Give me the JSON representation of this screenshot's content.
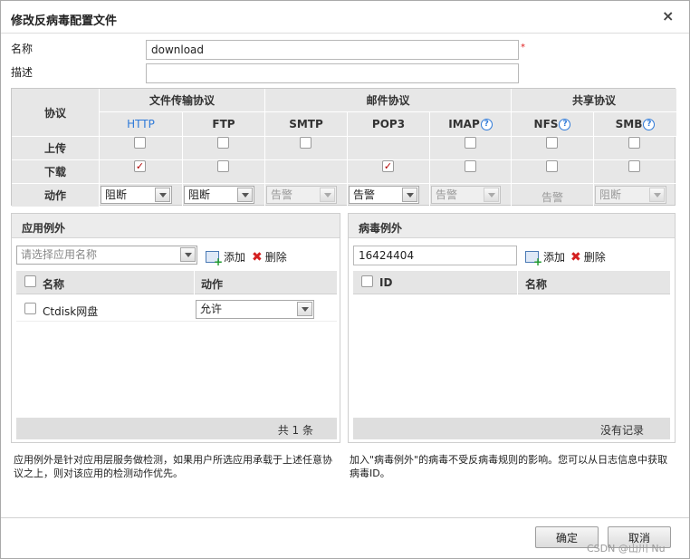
{
  "dialog": {
    "title": "修改反病毒配置文件",
    "close_glyph": "×"
  },
  "form": {
    "name_label": "名称",
    "name_value": "download",
    "required_mark": "*",
    "desc_label": "描述",
    "desc_value": ""
  },
  "protocols": {
    "row_header": "协议",
    "groups": [
      "文件传输协议",
      "邮件协议",
      "共享协议"
    ],
    "columns": [
      "HTTP",
      "FTP",
      "SMTP",
      "POP3",
      "IMAP",
      "NFS",
      "SMB"
    ],
    "help_glyph": "?",
    "rows": {
      "upload": "上传",
      "download": "下载",
      "action": "动作"
    },
    "check_glyph": "✓",
    "upload": [
      false,
      false,
      false,
      null,
      false,
      false,
      false
    ],
    "download": [
      true,
      false,
      null,
      true,
      false,
      false,
      false
    ],
    "actions": [
      "阻断",
      "阻断",
      "告警",
      "告警",
      "告警",
      "告警",
      "阻断"
    ],
    "active_color": "#2f7ad8"
  },
  "app_exception": {
    "title": "应用例外",
    "select_placeholder": "请选择应用名称",
    "add_label": "添加",
    "delete_label": "删除",
    "col_name": "名称",
    "col_action": "动作",
    "rows": [
      {
        "name": "Ctdisk网盘",
        "action": "允许"
      }
    ],
    "footer": "共 1 条",
    "note": "应用例外是针对应用层服务做检测，如果用户所选应用承载于上述任意协议之上，则对该应用的检测动作优先。"
  },
  "virus_exception": {
    "title": "病毒例外",
    "input_value": "16424404",
    "add_label": "添加",
    "delete_label": "删除",
    "col_id": "ID",
    "col_name": "名称",
    "footer": "没有记录",
    "note": "加入\"病毒例外\"的病毒不受反病毒规则的影响。您可以从日志信息中获取病毒ID。"
  },
  "buttons": {
    "ok": "确定",
    "cancel": "取消"
  },
  "watermark": "CSDN @山川 Nu"
}
